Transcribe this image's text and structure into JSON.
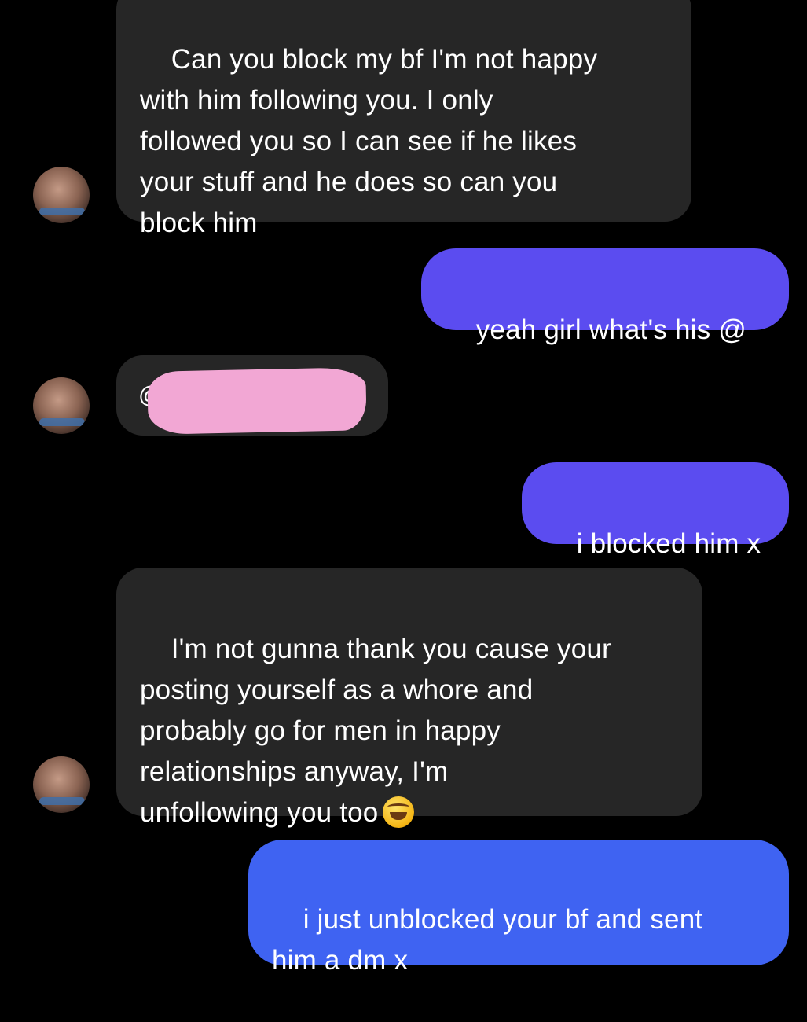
{
  "messages": [
    {
      "direction": "incoming",
      "text": "Can you block my bf I'm not happy\nwith him following you. I only\nfollowed you so I can see if he likes\nyour stuff and he does so can you\nblock him"
    },
    {
      "direction": "outgoing",
      "text": "yeah girl what's his @"
    },
    {
      "direction": "incoming",
      "text": "@",
      "redacted": true
    },
    {
      "direction": "outgoing",
      "text": "i blocked him x"
    },
    {
      "direction": "incoming",
      "text": "I'm not gunna thank you cause your\nposting yourself as a whore and\nprobably go for men in happy\nrelationships anyway, I'm\nunfollowing you too",
      "emoji": "rolling-on-floor-laughing-emoji"
    },
    {
      "direction": "outgoing",
      "text": "i just unblocked your bf and sent\nhim a dm x"
    }
  ],
  "colors": {
    "background": "#000000",
    "incoming_bubble": "#262626",
    "outgoing_bubble": "#5b4cf0",
    "outgoing_bubble_last": "#3f63f2",
    "redaction": "#f2a7d4"
  }
}
